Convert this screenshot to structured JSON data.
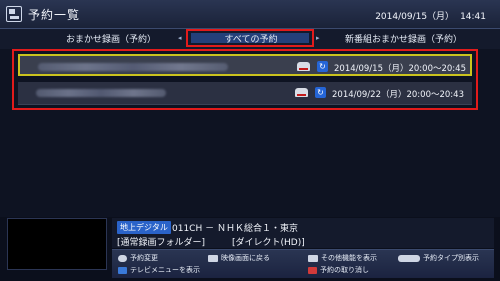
{
  "header": {
    "title": "予約一覧",
    "date": "2014/09/15（月）",
    "time": "14:41"
  },
  "tabs": {
    "left": "おまかせ録画（予約）",
    "center": "すべての予約",
    "right": "新番組おまかせ録画（予約）"
  },
  "reservations": [
    {
      "schedule": "2014/09/15（月）20:00～20:45"
    },
    {
      "schedule": "2014/09/22（月）20:00～20:43"
    }
  ],
  "info": {
    "badge": "地上デジタル",
    "channel": "011CH － ＮＨＫ総合１・東京",
    "folder": "[通常録画フォルダー]",
    "mode": "[ダイレクト(HD)]"
  },
  "help": {
    "edit": "予約変更",
    "back": "映像画面に戻る",
    "other": "その他機能を表示",
    "type": "予約タイプ別表示",
    "menu": "テレビメニューを表示",
    "cancel": "予約の取り消し"
  },
  "colors": {
    "highlight_red": "#e21b1b",
    "selection_yellow": "#cbc31e",
    "accent_blue": "#2a63c9"
  }
}
